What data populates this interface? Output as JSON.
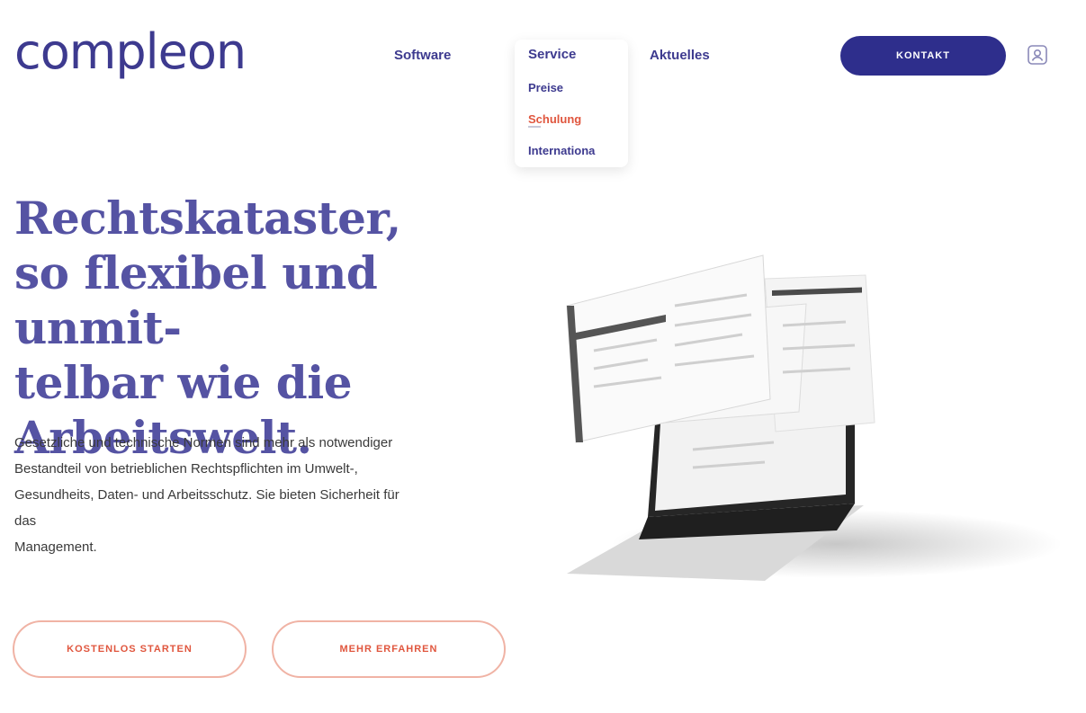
{
  "header": {
    "logo": "compleon",
    "nav": {
      "software": "Software",
      "service": "Service",
      "aktuelles": "Aktuelles"
    },
    "dropdown": {
      "items": [
        "Preise",
        "Schulung",
        "Internationa"
      ]
    },
    "contact_label": "KONTAKT",
    "user_icon": "user-icon"
  },
  "hero": {
    "headline_lines": [
      "Rechtskataster,",
      "so flexibel und unmit-",
      "telbar wie die",
      "Arbeitswelt."
    ],
    "intro_lines": [
      "Gesetzliche und technische Normen sind mehr als notwendiger",
      "Bestandteil von betrieblichen Rechtspflichten im Umwelt-,",
      "Gesundheits, Daten- und Arbeitsschutz. Sie bieten Sicherheit für",
      "das",
      "Management."
    ],
    "buttons": {
      "start": "KOSTENLOS STARTEN",
      "more": "MEHR ERFAHREN"
    }
  },
  "colors": {
    "brand": "#3d3a8f",
    "accent": "#e0563e",
    "button_dark": "#2e2e8c"
  }
}
